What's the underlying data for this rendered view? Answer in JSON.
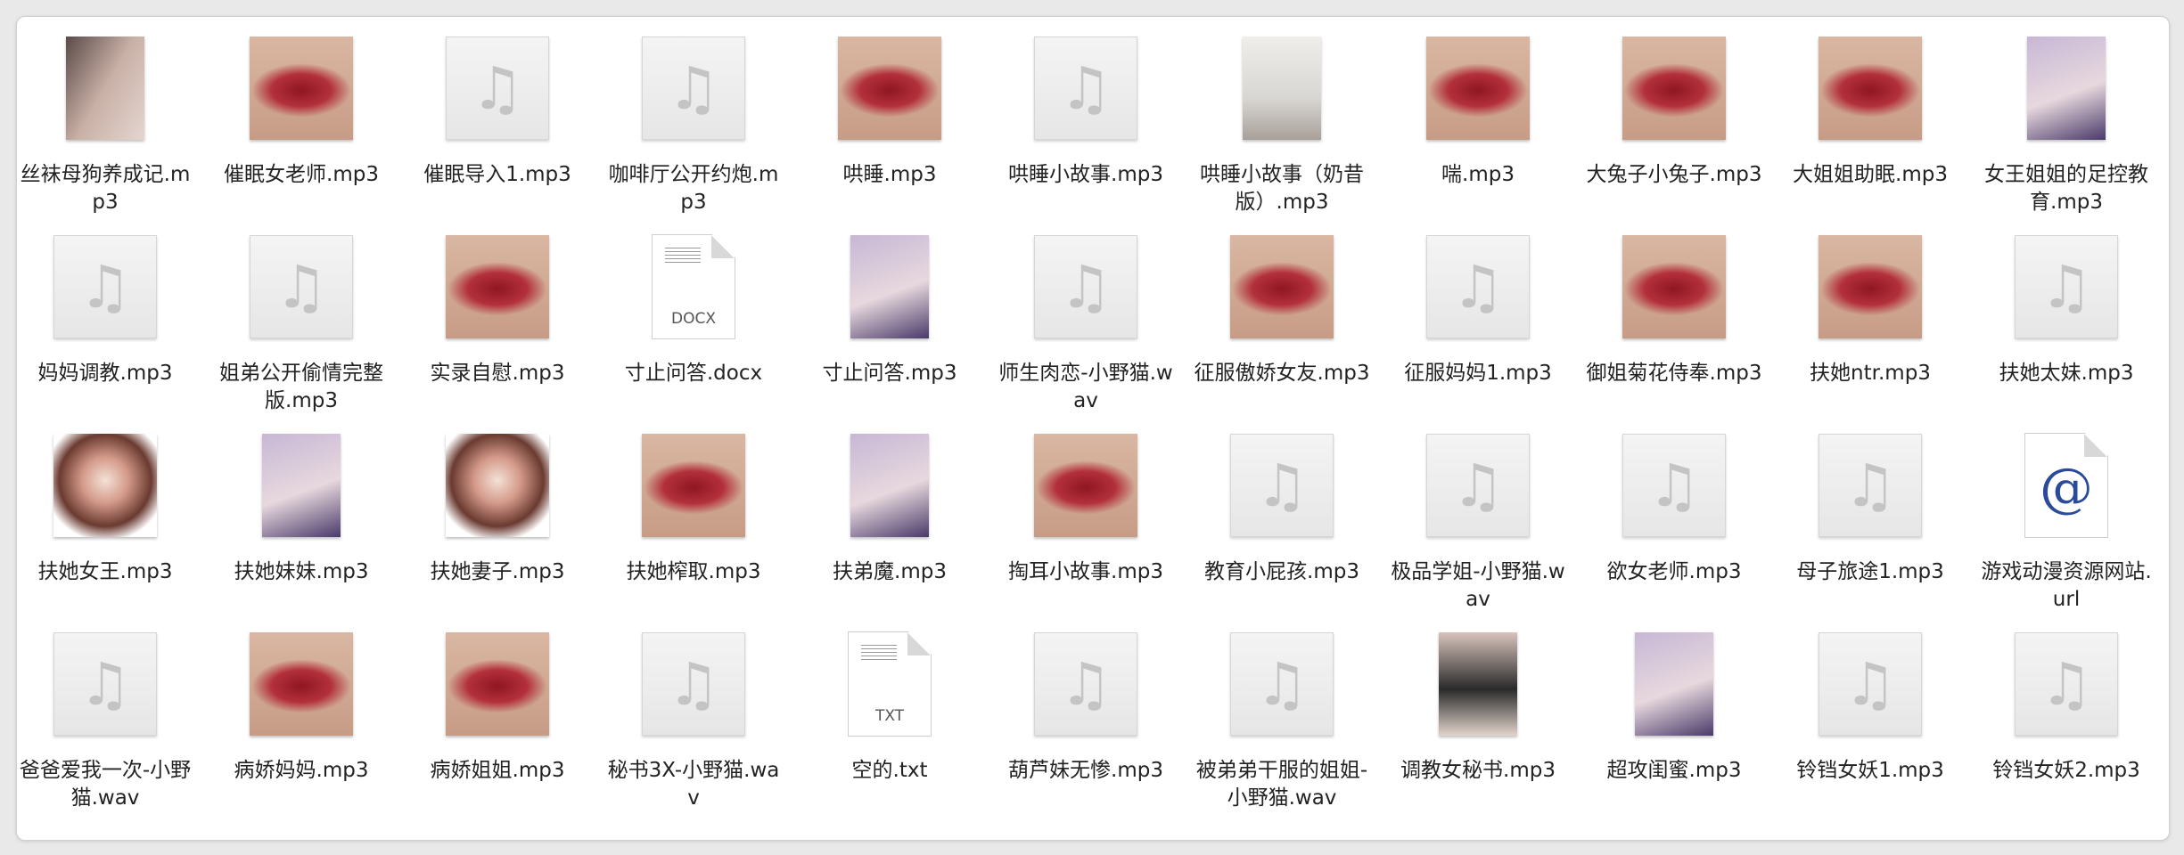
{
  "files": [
    {
      "name": "丝袜母狗养成记.mp3",
      "icon": "legs"
    },
    {
      "name": "催眠女老师.mp3",
      "icon": "lips"
    },
    {
      "name": "催眠导入1.mp3",
      "icon": "audio"
    },
    {
      "name": "咖啡厅公开约炮.mp3",
      "icon": "audio"
    },
    {
      "name": "哄睡.mp3",
      "icon": "lips"
    },
    {
      "name": "哄睡小故事.mp3",
      "icon": "audio"
    },
    {
      "name": "哄睡小故事（奶昔版）.mp3",
      "icon": "note"
    },
    {
      "name": "喘.mp3",
      "icon": "lips"
    },
    {
      "name": "大兔子小兔子.mp3",
      "icon": "lips"
    },
    {
      "name": "大姐姐助眠.mp3",
      "icon": "lips"
    },
    {
      "name": "女王姐姐的足控教育.mp3",
      "icon": "portrait"
    },
    {
      "name": "妈妈调教.mp3",
      "icon": "audio"
    },
    {
      "name": "姐弟公开偷情完整版.mp3",
      "icon": "audio"
    },
    {
      "name": "实录自慰.mp3",
      "icon": "lips"
    },
    {
      "name": "寸止问答.docx",
      "icon": "docx",
      "ext": "DOCX"
    },
    {
      "name": "寸止问答.mp3",
      "icon": "portrait"
    },
    {
      "name": "师生肉恋-小野猫.wav",
      "icon": "audio"
    },
    {
      "name": "征服傲娇女友.mp3",
      "icon": "lips"
    },
    {
      "name": "征服妈妈1.mp3",
      "icon": "audio"
    },
    {
      "name": "御姐菊花侍奉.mp3",
      "icon": "lips"
    },
    {
      "name": "扶她ntr.mp3",
      "icon": "lips"
    },
    {
      "name": "扶她太妹.mp3",
      "icon": "audio"
    },
    {
      "name": "扶她女王.mp3",
      "icon": "anime"
    },
    {
      "name": "扶她妹妹.mp3",
      "icon": "portrait"
    },
    {
      "name": "扶她妻子.mp3",
      "icon": "anime"
    },
    {
      "name": "扶她榨取.mp3",
      "icon": "lips"
    },
    {
      "name": "扶弟魔.mp3",
      "icon": "portrait"
    },
    {
      "name": "掏耳小故事.mp3",
      "icon": "lips"
    },
    {
      "name": "教育小屁孩.mp3",
      "icon": "audio"
    },
    {
      "name": "极品学姐-小野猫.wav",
      "icon": "audio"
    },
    {
      "name": "欲女老师.mp3",
      "icon": "audio"
    },
    {
      "name": "母子旅途1.mp3",
      "icon": "audio"
    },
    {
      "name": "游戏动漫资源网站.url",
      "icon": "url",
      "ext": "@"
    },
    {
      "name": "爸爸爱我一次-小野猫.wav",
      "icon": "audio"
    },
    {
      "name": "病娇妈妈.mp3",
      "icon": "lips"
    },
    {
      "name": "病娇姐姐.mp3",
      "icon": "lips"
    },
    {
      "name": "秘书3X-小野猫.wav",
      "icon": "audio"
    },
    {
      "name": "空的.txt",
      "icon": "txt",
      "ext": "TXT"
    },
    {
      "name": "葫芦妹无惨.mp3",
      "icon": "audio"
    },
    {
      "name": "被弟弟干服的姐姐-小野猫.wav",
      "icon": "audio"
    },
    {
      "name": "调教女秘书.mp3",
      "icon": "dark"
    },
    {
      "name": "超攻闺蜜.mp3",
      "icon": "portrait"
    },
    {
      "name": "铃铛女妖1.mp3",
      "icon": "audio"
    },
    {
      "name": "铃铛女妖2.mp3",
      "icon": "audio"
    }
  ]
}
